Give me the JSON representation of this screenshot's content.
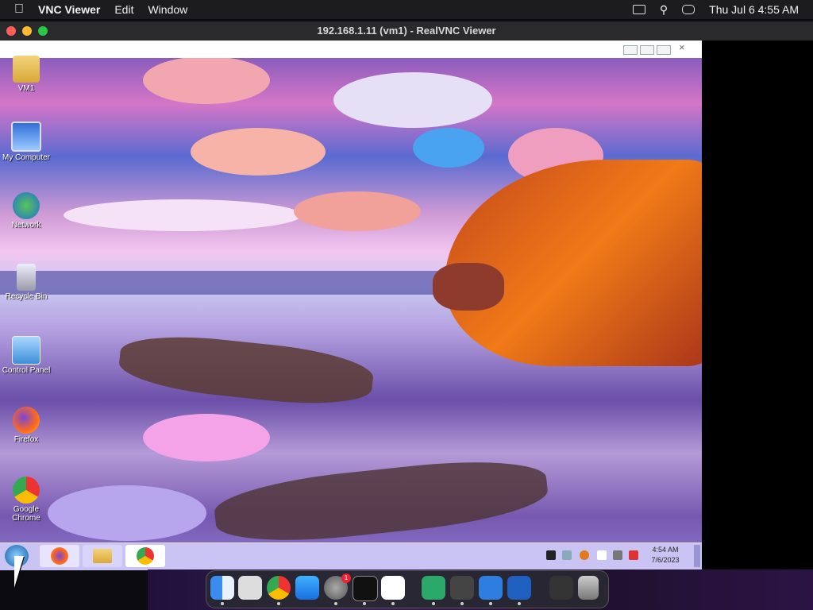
{
  "menubar": {
    "app_name": "VNC Viewer",
    "items": [
      "Edit",
      "Window"
    ],
    "datetime": "Thu Jul 6  4:55 AM"
  },
  "window": {
    "title": "192.168.1.11 (vm1) - RealVNC Viewer"
  },
  "desktop": {
    "icons": [
      {
        "label": "VM1",
        "icon": "folder-icon"
      },
      {
        "label": "My Computer",
        "icon": "computer-icon"
      },
      {
        "label": "Network",
        "icon": "network-icon"
      },
      {
        "label": "Recycle Bin",
        "icon": "recycle-bin-icon"
      },
      {
        "label": "Control Panel",
        "icon": "control-panel-icon"
      },
      {
        "label": "Firefox",
        "icon": "firefox-icon"
      },
      {
        "label": "Google Chrome",
        "icon": "chrome-icon"
      }
    ]
  },
  "taskbar": {
    "buttons": [
      "start",
      "firefox",
      "explorer",
      "chrome"
    ],
    "clock_time": "4:54 AM",
    "clock_date": "7/6/2023"
  },
  "dock": {
    "apps": [
      "finder",
      "launchpad",
      "chrome",
      "app-store",
      "system-settings",
      "terminal",
      "vscode",
      "app-1",
      "app-2",
      "app-3",
      "app-4",
      "vnc-viewer",
      "trash"
    ],
    "settings_badge": "1"
  },
  "colors": {
    "menubar_bg": "#1c1c1e",
    "taskbar_bg": "#c9c4f4",
    "close": "#ff5f57",
    "minimize": "#febc2e",
    "maximize": "#28c840"
  }
}
